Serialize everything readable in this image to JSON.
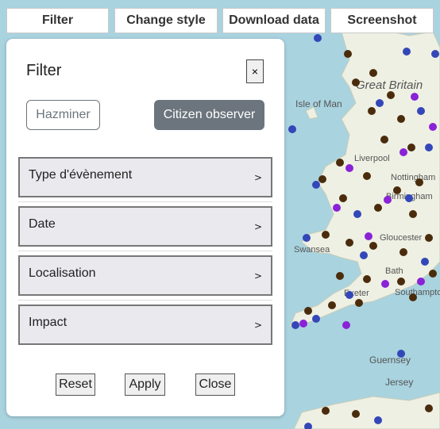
{
  "toolbar": {
    "filter_label": "Filter",
    "change_style_label": "Change style",
    "download_label": "Download data",
    "screenshot_label": "Screenshot"
  },
  "map": {
    "labels": [
      "Great Britain",
      "Isle of Man",
      "Liverpool",
      "Nottingham",
      "Birmingham",
      "Swansea",
      "Gloucester",
      "Bath",
      "Exeter",
      "Southampton",
      "Guernsey",
      "Jersey"
    ],
    "marker_colors": {
      "brown": "#4a2c0c",
      "blue": "#3347b8",
      "purple": "#8a22d6"
    }
  },
  "panel": {
    "title": "Filter",
    "close_symbol": "×",
    "toggles": {
      "hazminer": "Hazminer",
      "citizen": "Citizen observer"
    },
    "sections": [
      {
        "label": "Type d'évènement",
        "arrow": ">"
      },
      {
        "label": "Date",
        "arrow": ">"
      },
      {
        "label": "Localisation",
        "arrow": ">"
      },
      {
        "label": "Impact",
        "arrow": ">"
      }
    ],
    "buttons": {
      "reset": "Reset",
      "apply": "Apply",
      "close": "Close"
    }
  }
}
